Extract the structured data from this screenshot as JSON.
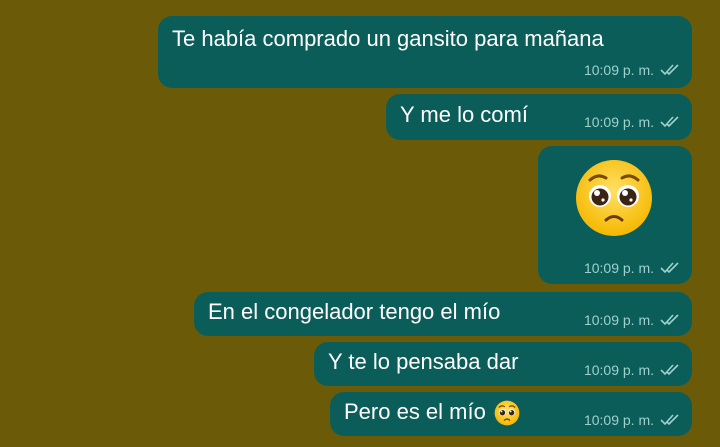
{
  "messages": [
    {
      "text": "Te había comprado un gansito para mañana",
      "time": "10:09 p. m."
    },
    {
      "text": "Y me lo comí",
      "time": "10:09 p. m."
    },
    {
      "emoji": "pleading-face",
      "time": "10:09 p. m."
    },
    {
      "text": "En el congelador tengo el mío",
      "time": "10:09 p. m."
    },
    {
      "text": "Y te lo pensaba dar",
      "time": "10:09 p. m."
    },
    {
      "text": "Pero es el mío",
      "emoji": "pleading-face",
      "time": "10:09 p. m."
    }
  ],
  "colors": {
    "background": "#6b5a08",
    "bubble": "#0b5d5a",
    "meta": "#9fd1cc"
  }
}
